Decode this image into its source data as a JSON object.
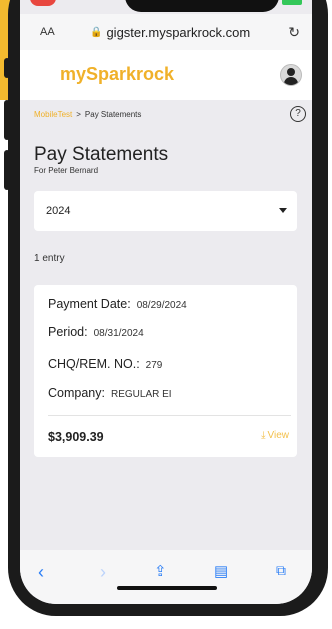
{
  "browser": {
    "text_size_label": "AA",
    "url": "gigster.mysparkrock.com"
  },
  "header": {
    "brand": "mySparkrock"
  },
  "breadcrumb": {
    "parent": "MobileTest",
    "separator": ">",
    "current": "Pay Statements"
  },
  "page": {
    "title": "Pay Statements",
    "subtitle": "For Peter Bernard"
  },
  "filter": {
    "year": "2024"
  },
  "list": {
    "count_label": "1 entry",
    "entries": [
      {
        "payment_date_label": "Payment Date:",
        "payment_date": "08/29/2024",
        "period_label": "Period:",
        "period": "08/31/2024",
        "chq_label": "CHQ/REM. NO.:",
        "chq": "279",
        "company_label": "Company:",
        "company": "REGULAR EI",
        "amount": "$3,909.39",
        "view_label": "View"
      }
    ]
  },
  "colors": {
    "brand": "#f0b12a",
    "link": "#2b7ef6",
    "background": "#ecebef"
  },
  "icons": {
    "lock": "lock-icon",
    "reload": "reload-icon",
    "help": "help-circle-icon",
    "download": "download-icon",
    "back": "chevron-left-icon",
    "forward": "chevron-right-icon",
    "share": "share-icon",
    "bookmarks": "book-icon",
    "tabs": "tabs-icon"
  }
}
